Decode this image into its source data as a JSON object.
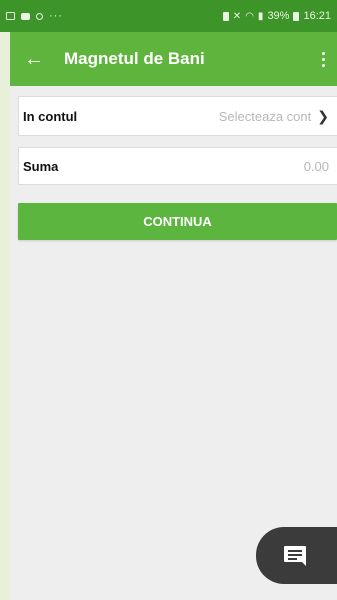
{
  "status_bar": {
    "notification_icons": [
      "image-icon",
      "chat-bubble-icon",
      "circle-icon"
    ],
    "more": "···",
    "battery": "39%",
    "time": "16:21"
  },
  "app_bar": {
    "back_icon": "←",
    "title": "Magnetul de Bani",
    "menu_icon": "more-vert-icon"
  },
  "form": {
    "account": {
      "label": "In contul",
      "value": "Selecteaza cont",
      "chevron": "❯"
    },
    "amount": {
      "label": "Suma",
      "value": "0.00"
    }
  },
  "actions": {
    "continue_label": "CONTINUA"
  },
  "fab": {
    "icon": "chat-icon"
  },
  "colors": {
    "status_bar": "#3d9428",
    "app_bar": "#5fb43e",
    "primary_button": "#5bb53f",
    "background": "#eeeeee",
    "fab": "#3b3b3b"
  }
}
